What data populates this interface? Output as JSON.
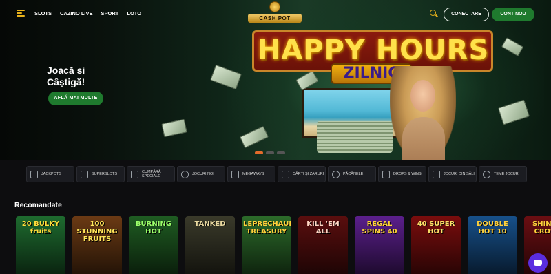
{
  "header": {
    "nav": [
      "SLOTS",
      "CAZINO LIVE",
      "SPORT",
      "LOTO"
    ],
    "logo_text": "CASH POT",
    "login_label": "CONECTARE",
    "signup_label": "CONT NOU"
  },
  "hero": {
    "title_line1": "Joacă si",
    "title_line2": "Câștigă!",
    "cta_label": "AFLĂ MAI MULTE",
    "banner_title": "HAPPY HOURS",
    "banner_subtitle": "ZILNIC",
    "slides": 3,
    "active_slide": 1
  },
  "categories": [
    {
      "label": "JACKPOTS",
      "icon": "jackpot-logo-icon"
    },
    {
      "label": "SUPERSLOTS",
      "icon": "slot-machine-icon"
    },
    {
      "label": "CUMPĂRĂ SPECIALE",
      "icon": "buy-feature-icon"
    },
    {
      "label": "JOCURI NOI",
      "icon": "compass-icon"
    },
    {
      "label": "MEGAWAYS",
      "icon": "grid-icon"
    },
    {
      "label": "CĂRȚI ȘI ZARURI",
      "icon": "cards-dice-icon"
    },
    {
      "label": "PĂCĂNELE",
      "icon": "fruits-icon"
    },
    {
      "label": "DROPS & WINS",
      "icon": "plane-icon"
    },
    {
      "label": "JOCURI DIN SĂLI",
      "icon": "arcade-cabinet-icon"
    },
    {
      "label": "TEME JOCURI",
      "icon": "theme-icon"
    }
  ],
  "recommended": {
    "title": "Recomandate",
    "games": [
      {
        "name": "20 BULKY fruits",
        "bg": "#1e6b2f",
        "fg": "#ffde3a"
      },
      {
        "name": "100 STUNNING FRUITS",
        "bg": "#6b3a14",
        "fg": "#ffe55a"
      },
      {
        "name": "BURNING HOT",
        "bg": "#1f5c22",
        "fg": "#9cff6a"
      },
      {
        "name": "TANKED",
        "bg": "#3a3a2a",
        "fg": "#e9d9a0"
      },
      {
        "name": "LEPRECHAUN TREASURY",
        "bg": "#2c6b2a",
        "fg": "#ffd23b"
      },
      {
        "name": "KILL 'EM ALL",
        "bg": "#5a0e0e",
        "fg": "#ffd6c4"
      },
      {
        "name": "REGAL SPINS 40",
        "bg": "#5b1f8c",
        "fg": "#ffd23b"
      },
      {
        "name": "40 SUPER HOT",
        "bg": "#7a0d0d",
        "fg": "#ffe36a"
      },
      {
        "name": "DOUBLE HOT 10",
        "bg": "#17508a",
        "fg": "#ffd23b"
      },
      {
        "name": "SHINING CROWN",
        "bg": "#6b0e12",
        "fg": "#ffd23b"
      }
    ]
  }
}
